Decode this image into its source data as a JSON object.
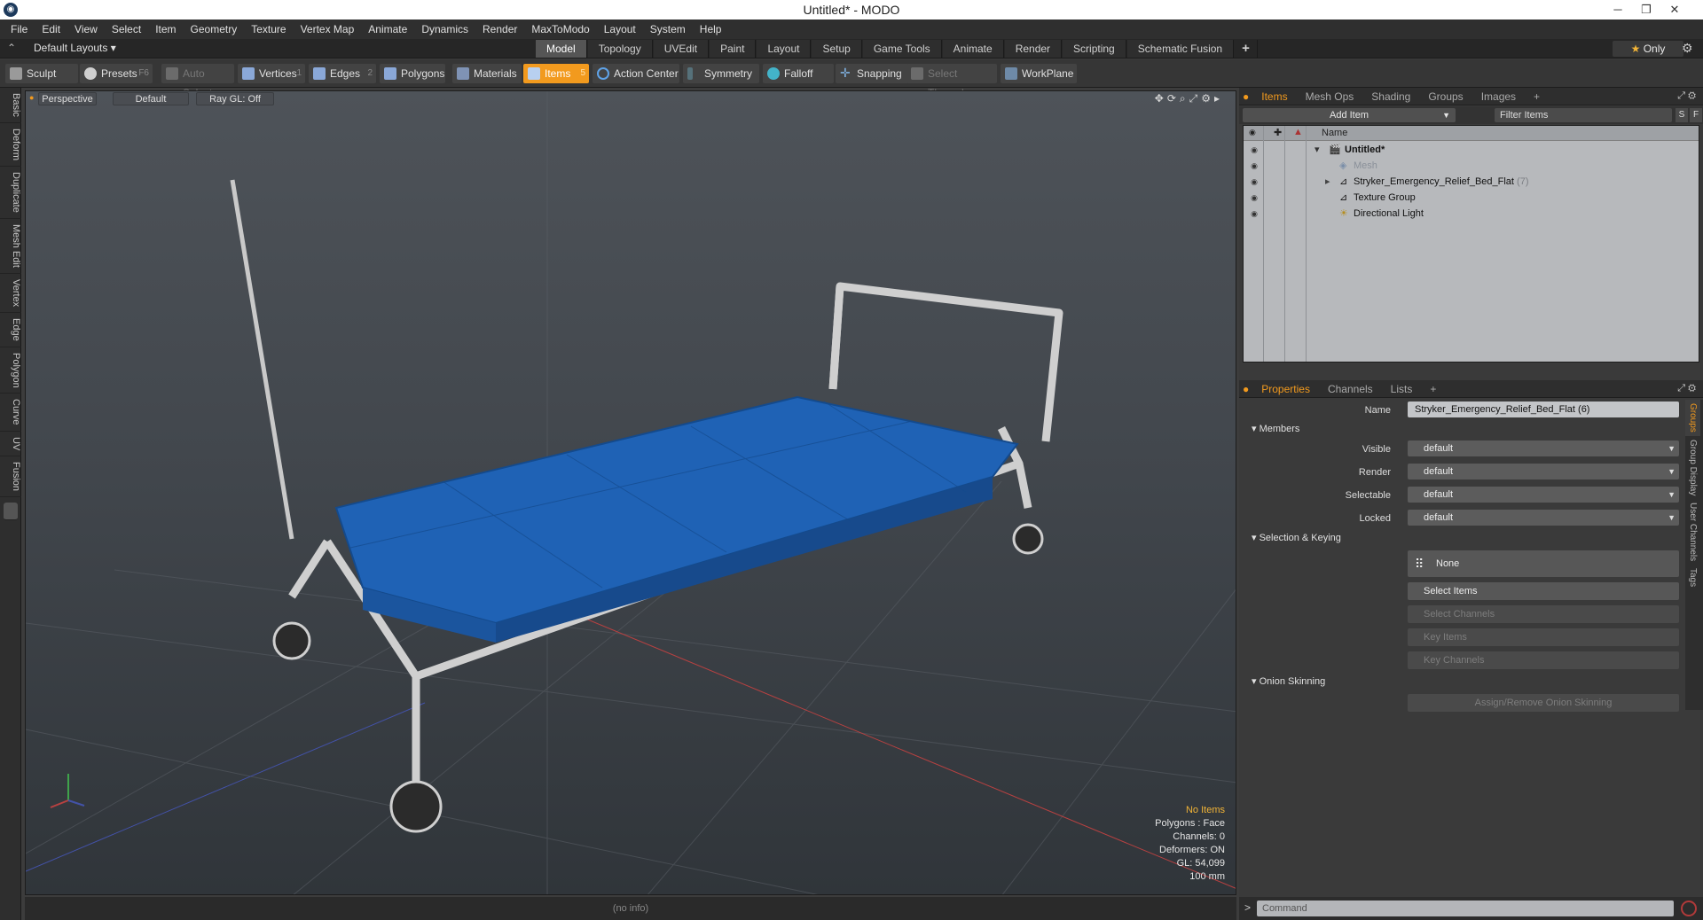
{
  "window": {
    "title": "Untitled* - MODO"
  },
  "menu": [
    "File",
    "Edit",
    "View",
    "Select",
    "Item",
    "Geometry",
    "Texture",
    "Vertex Map",
    "Animate",
    "Dynamics",
    "Render",
    "MaxToModo",
    "Layout",
    "System",
    "Help"
  ],
  "layout": {
    "name": "Default Layouts",
    "tabs": [
      "Model",
      "Topology",
      "UVEdit",
      "Paint",
      "Layout",
      "Setup",
      "Game Tools",
      "Animate",
      "Render",
      "Scripting",
      "Schematic Fusion"
    ],
    "active_tab": "Model",
    "only_label": "Only"
  },
  "toolbar": {
    "sculpt": "Sculpt",
    "presets": "Presets",
    "presets_key": "F6",
    "auto_select": "Auto Select",
    "vertices": "Vertices",
    "vertices_num": "1",
    "edges": "Edges",
    "edges_num": "2",
    "polygons": "Polygons",
    "materials": "Materials",
    "items": "Items",
    "items_num": "5",
    "action_center": "Action Center",
    "symmetry": "Symmetry",
    "falloff": "Falloff",
    "snapping": "Snapping",
    "select_through": "Select Through",
    "workplane": "WorkPlane"
  },
  "left_tabs": [
    "Basic",
    "Deform",
    "Duplicate",
    "Mesh Edit",
    "Vertex",
    "Edge",
    "Polygon",
    "Curve",
    "UV",
    "Fusion"
  ],
  "viewport": {
    "view": "Perspective",
    "shading": "Default",
    "raygl": "Ray GL: Off",
    "stats": {
      "selection": "No Items",
      "polygons": "Polygons : Face",
      "channels": "Channels: 0",
      "deformers": "Deformers: ON",
      "gl": "GL: 54,099",
      "scale": "100 mm"
    },
    "status": "(no info)"
  },
  "items_panel": {
    "tabs": [
      "Items",
      "Mesh Ops",
      "Shading",
      "Groups",
      "Images"
    ],
    "active_tab": "Items",
    "add_item": "Add Item",
    "filter_placeholder": "Filter Items",
    "col_name": "Name",
    "tree": [
      {
        "label": "Untitled*",
        "count": ""
      },
      {
        "label": "Mesh",
        "count": ""
      },
      {
        "label": "Stryker_Emergency_Relief_Bed_Flat",
        "count": "(7)"
      },
      {
        "label": "Texture Group",
        "count": ""
      },
      {
        "label": "Directional Light",
        "count": ""
      }
    ]
  },
  "properties": {
    "tabs": [
      "Properties",
      "Channels",
      "Lists"
    ],
    "active_tab": "Properties",
    "name_label": "Name",
    "name_value": "Stryker_Emergency_Relief_Bed_Flat (6)",
    "members_section": "Members",
    "visible_label": "Visible",
    "visible_value": "default",
    "render_label": "Render",
    "render_value": "default",
    "selectable_label": "Selectable",
    "selectable_value": "default",
    "locked_label": "Locked",
    "locked_value": "default",
    "selection_section": "Selection & Keying",
    "none_label": "None",
    "select_items": "Select Items",
    "select_channels": "Select Channels",
    "key_items": "Key Items",
    "key_channels": "Key Channels",
    "onion_section": "Onion Skinning",
    "assign_onion": "Assign/Remove Onion Skinning",
    "side_tabs": [
      "Groups",
      "Group Display",
      "User Channels",
      "Tags"
    ]
  },
  "command": {
    "placeholder": "Command"
  },
  "colors": {
    "accent": "#f29a1e",
    "mattress": "#1f62b5",
    "frame": "#c9c9c9"
  }
}
